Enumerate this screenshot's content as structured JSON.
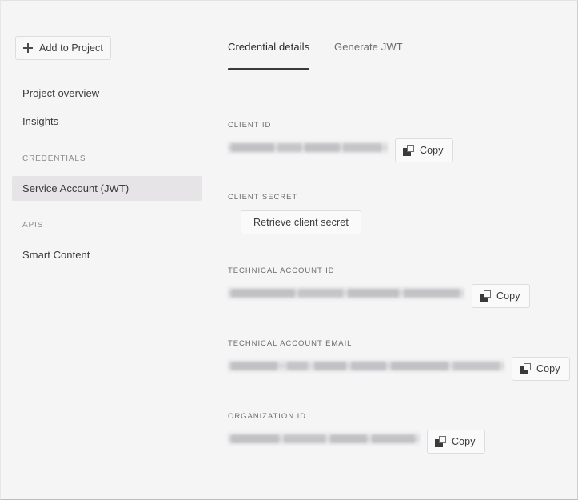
{
  "sidebar": {
    "add_button": {
      "label": "Add to Project",
      "icon": "plus-icon"
    },
    "links": [
      {
        "label": "Project overview",
        "selected": false
      },
      {
        "label": "Insights",
        "selected": false
      },
      {
        "label": "Service Account (JWT)",
        "selected": true
      },
      {
        "label": "Smart Content",
        "selected": false
      }
    ],
    "sections": [
      {
        "label": "CREDENTIALS"
      },
      {
        "label": "APIS"
      }
    ]
  },
  "main": {
    "tabs": [
      {
        "label": "Credential details",
        "active": true
      },
      {
        "label": "Generate JWT",
        "active": false
      }
    ],
    "fields": [
      {
        "label": "CLIENT ID",
        "value": "",
        "value_masked": true,
        "value_width": 200,
        "action": {
          "type": "copy",
          "label": "Copy",
          "icon": "copy-icon"
        }
      },
      {
        "label": "CLIENT SECRET",
        "value": "",
        "value_masked": false,
        "action": {
          "type": "button",
          "label": "Retrieve client secret"
        }
      },
      {
        "label": "TECHNICAL ACCOUNT ID",
        "value": "",
        "value_masked": true,
        "value_width": 296,
        "action": {
          "type": "copy",
          "label": "Copy",
          "icon": "copy-icon"
        }
      },
      {
        "label": "TECHNICAL ACCOUNT EMAIL",
        "value": "",
        "value_masked": true,
        "value_width": 346,
        "action": {
          "type": "copy",
          "label": "Copy",
          "icon": "copy-icon"
        }
      },
      {
        "label": "ORGANIZATION ID",
        "value": "",
        "value_masked": true,
        "value_width": 240,
        "action": {
          "type": "copy",
          "label": "Copy",
          "icon": "copy-icon"
        }
      }
    ]
  },
  "colors": {
    "background": "#f6f5f6",
    "selected_nav": "#e6e4e6",
    "active_tab_underline": "#3b393b",
    "text_primary": "#3b393b",
    "text_muted": "#6e6c6e"
  }
}
